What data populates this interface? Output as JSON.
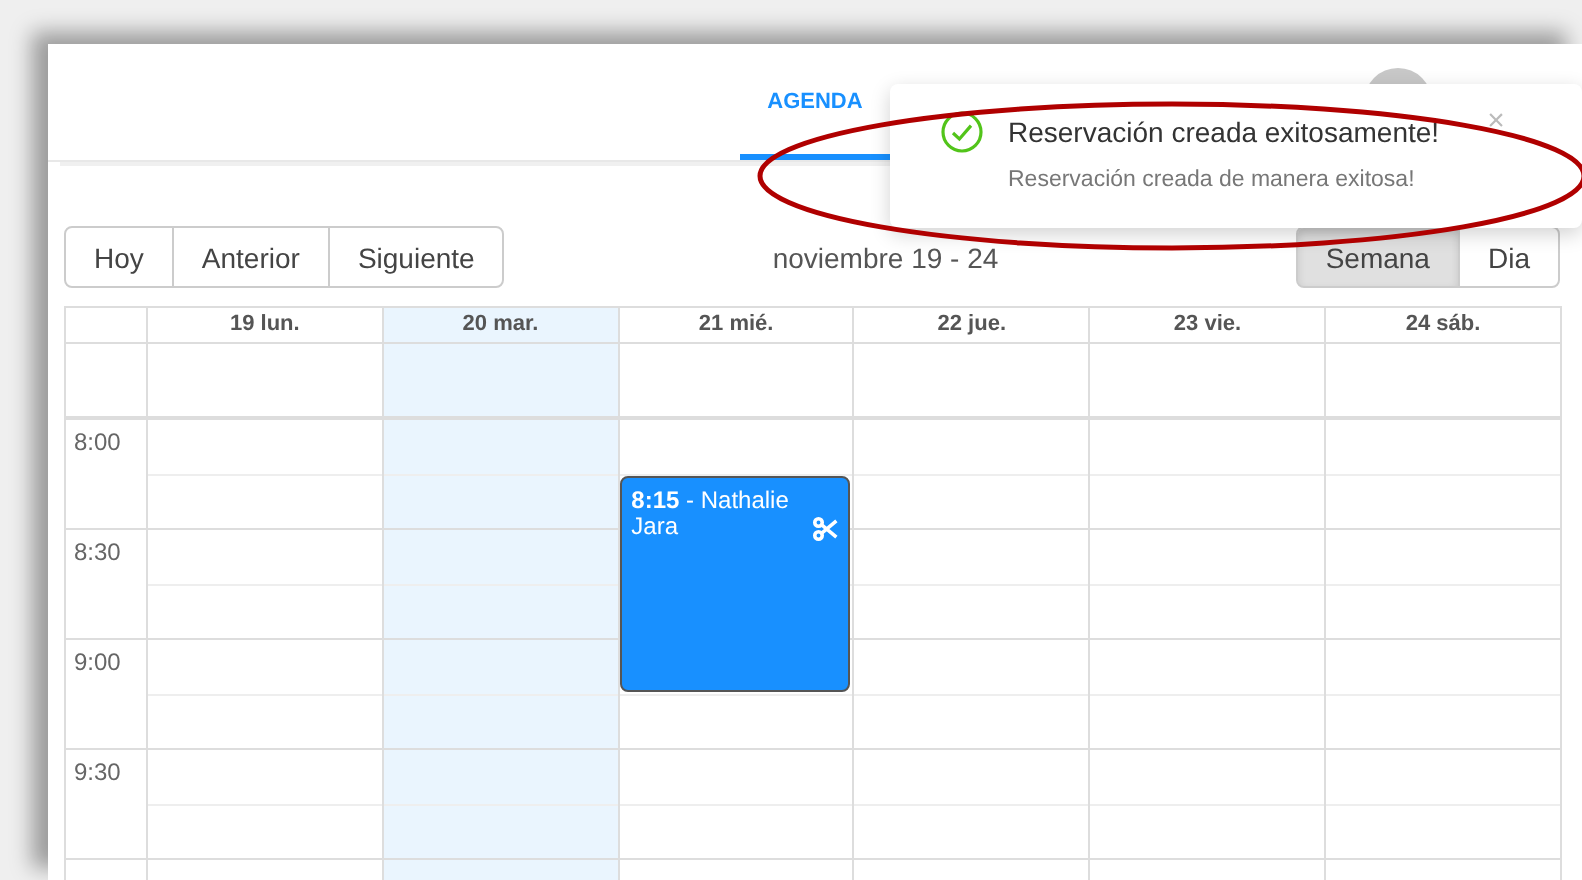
{
  "nav_tabs": [
    {
      "label": "AGENDA",
      "selected": true
    }
  ],
  "toast": {
    "kind": "success",
    "title": "Reservación creada exitosamente!",
    "message": "Reservación creada de manera exitosa!",
    "close": "×"
  },
  "toolbar": {
    "nav_buttons": [
      "Hoy",
      "Anterior",
      "Siguiente"
    ],
    "title": "noviembre 19 - 24",
    "views": [
      {
        "label": "Semana",
        "selected": true
      },
      {
        "label": "Dia",
        "selected": false
      }
    ]
  },
  "calendar": {
    "times": [
      "8:00",
      "8:30",
      "9:00",
      "9:30"
    ],
    "days": [
      {
        "label": "19 lun.",
        "today": false
      },
      {
        "label": "20 mar.",
        "today": true
      },
      {
        "label": "21 mié.",
        "today": false,
        "events": [
          {
            "text": "**8:15** - Nathalie Jara"
          }
        ]
      },
      {
        "label": "22 jue.",
        "today": false
      },
      {
        "label": "23 vie.",
        "today": false
      },
      {
        "label": "24 sáb.",
        "today": false
      }
    ]
  }
}
